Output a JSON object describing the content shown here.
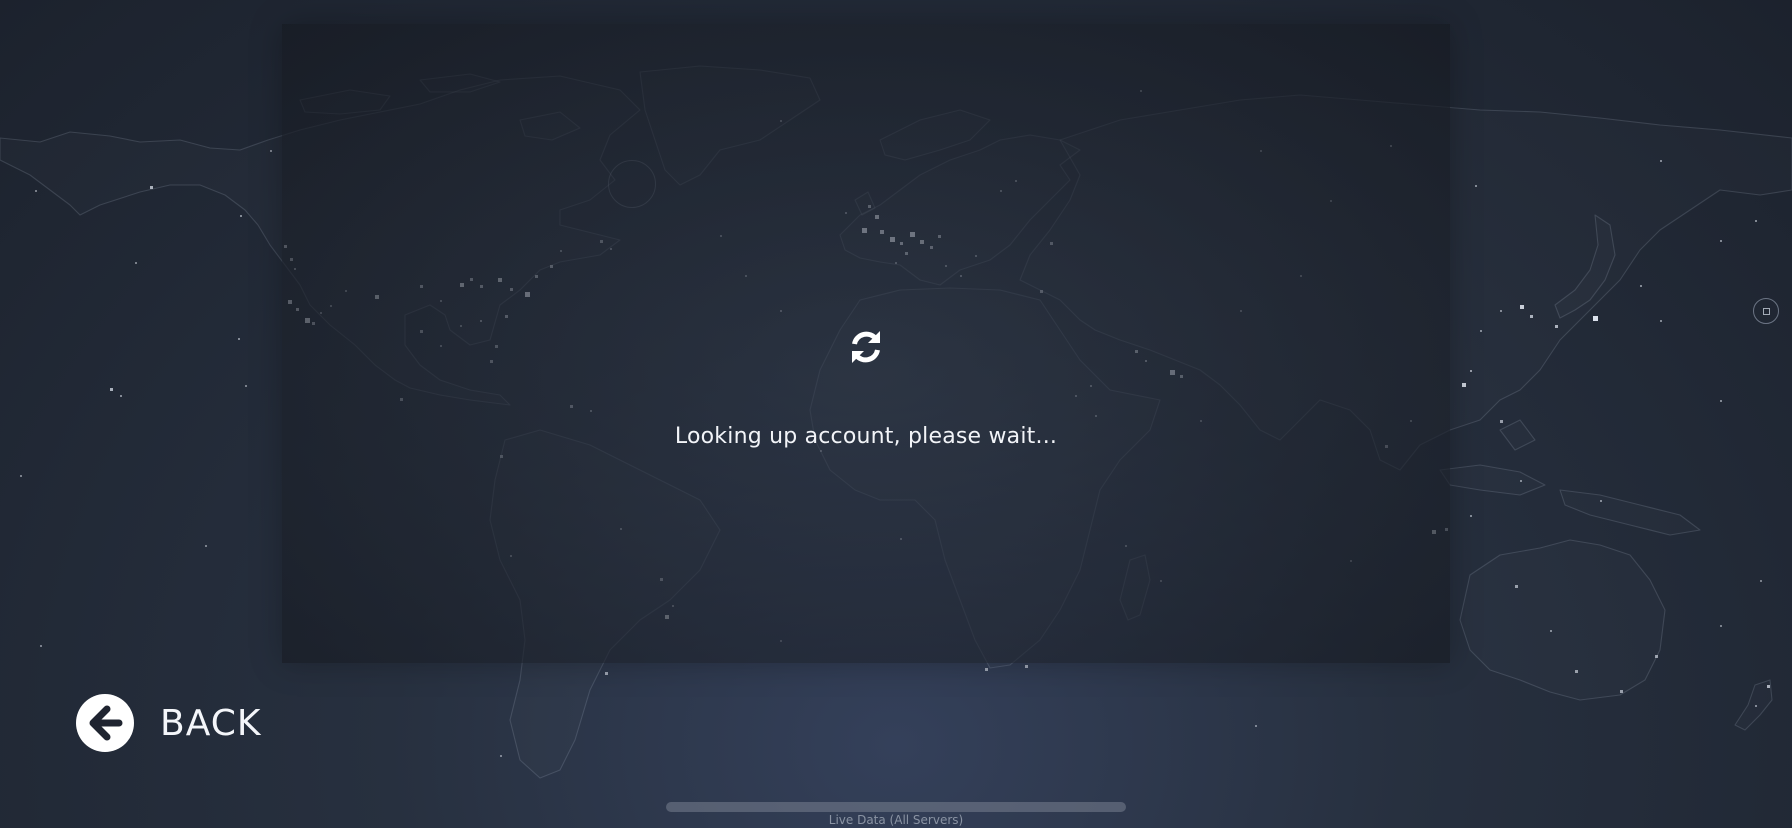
{
  "dialog": {
    "status_text": "Looking up account, please wait...",
    "spinner_icon": "refresh-icon"
  },
  "back_button": {
    "label": "BACK",
    "icon": "arrow-left-icon"
  },
  "footer": {
    "label": "Live Data (All Servers)"
  },
  "colors": {
    "background": "#222a38",
    "dialog_overlay": "#161a22",
    "text": "#f2f4f8",
    "footer_text": "#8a93a3",
    "dot": "#e6ebf5"
  }
}
